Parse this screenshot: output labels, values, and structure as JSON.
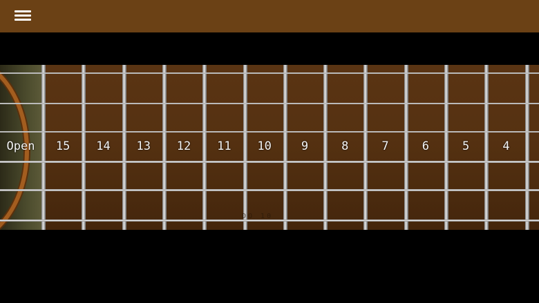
{
  "toolbar": {
    "menu_icon": "hamburger-menu-icon",
    "background_color": "#6b4115"
  },
  "fretboard": {
    "open_label": "Open",
    "frets": [
      "15",
      "14",
      "13",
      "12",
      "11",
      "10",
      "9",
      "8",
      "7",
      "6",
      "5",
      "4"
    ],
    "ghost_text": "DO  10",
    "string_count": 6,
    "colors": {
      "wood": "#553111",
      "fret_wire": "#dcdcdc",
      "rosette": "#a35d1f"
    }
  }
}
